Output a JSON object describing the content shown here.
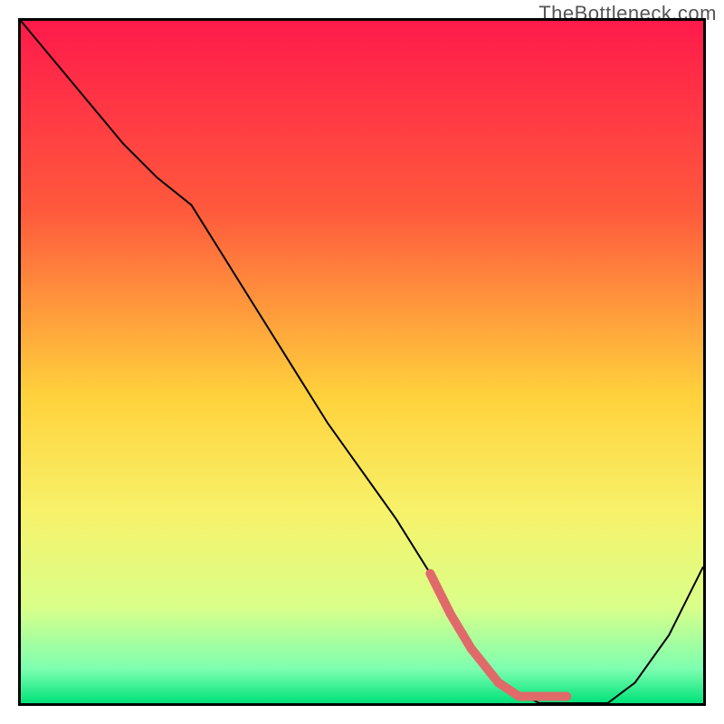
{
  "watermark": "TheBottleneck.com",
  "chart_data": {
    "type": "line",
    "title": "",
    "xlabel": "",
    "ylabel": "",
    "xlim": [
      0,
      100
    ],
    "ylim": [
      0,
      100
    ],
    "gradient_stops": [
      {
        "offset": 0,
        "color": "#ff1a4b"
      },
      {
        "offset": 28,
        "color": "#ff5a3c"
      },
      {
        "offset": 55,
        "color": "#ffd23c"
      },
      {
        "offset": 72,
        "color": "#f7f26a"
      },
      {
        "offset": 86,
        "color": "#d9ff8a"
      },
      {
        "offset": 95,
        "color": "#7dffb0"
      },
      {
        "offset": 100,
        "color": "#00e27a"
      }
    ],
    "series": [
      {
        "name": "bottleneck-curve",
        "x": [
          0,
          5,
          10,
          15,
          20,
          25,
          30,
          35,
          40,
          45,
          50,
          55,
          60,
          63,
          66,
          70,
          76,
          82,
          86,
          90,
          95,
          100
        ],
        "y": [
          100,
          94,
          88,
          82,
          77,
          73,
          65,
          57,
          49,
          41,
          34,
          27,
          19,
          13,
          8,
          3,
          0,
          0,
          0,
          3,
          10,
          20
        ],
        "color": "#000000",
        "width": 2
      }
    ],
    "highlight": {
      "name": "highlight-segment",
      "x": [
        60,
        63,
        66,
        70,
        73,
        75,
        78,
        80
      ],
      "y": [
        19,
        13,
        8,
        3,
        1,
        1,
        1,
        1
      ],
      "color": "#e06a6a",
      "width": 10,
      "dots": [
        {
          "x": 75,
          "y": 1
        },
        {
          "x": 78,
          "y": 1
        },
        {
          "x": 80,
          "y": 1
        }
      ]
    }
  }
}
